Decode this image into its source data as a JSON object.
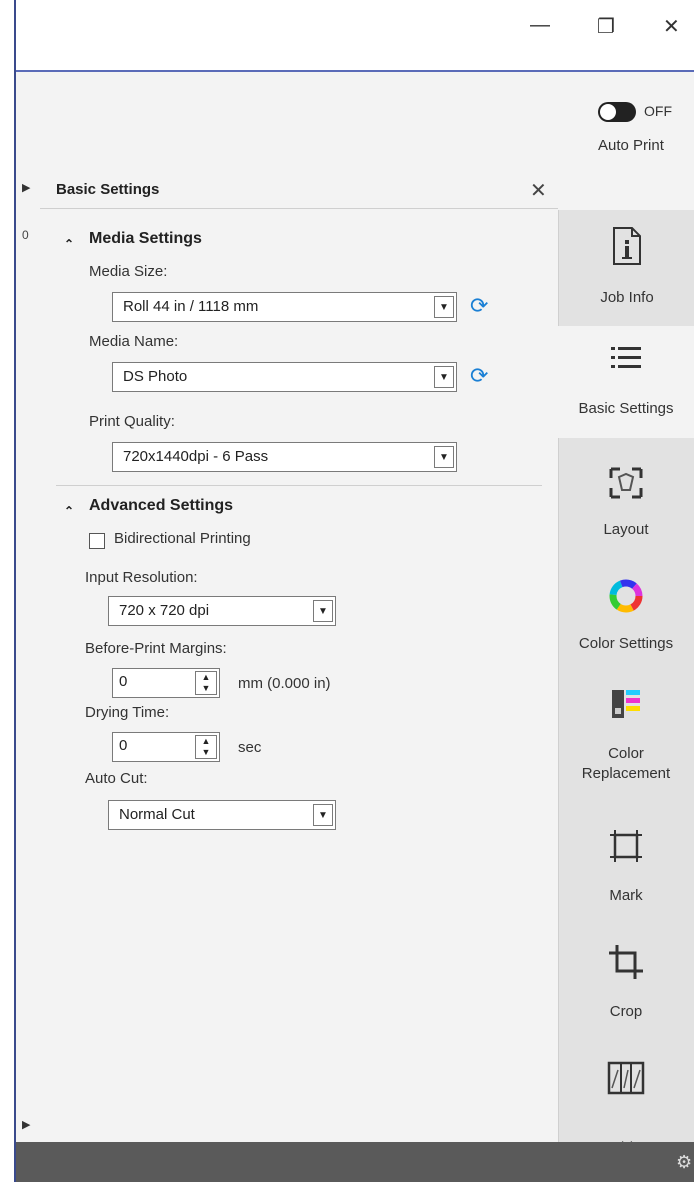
{
  "window": {
    "minimize_glyph": "—",
    "restore_glyph": "❐",
    "close_glyph": "✕"
  },
  "toolbar": {
    "auto_print_state": "OFF",
    "auto_print_label": "Auto Print"
  },
  "panel": {
    "title": "Basic Settings",
    "close_glyph": "✕",
    "media_settings": {
      "heading": "Media Settings",
      "media_size_label": "Media Size:",
      "media_size_value": "Roll 44 in / 1118 mm",
      "media_name_label": "Media Name:",
      "media_name_value": "DS Photo",
      "print_quality_label": "Print Quality:",
      "print_quality_value": "720x1440dpi - 6 Pass"
    },
    "advanced_settings": {
      "heading": "Advanced Settings",
      "bidirectional_label": "Bidirectional Printing",
      "bidirectional_checked": false,
      "input_resolution_label": "Input Resolution:",
      "input_resolution_value": "720 x 720 dpi",
      "before_print_margins_label": "Before-Print Margins:",
      "before_print_margins_value": "0",
      "before_print_margins_unit": "mm  (0.000 in)",
      "drying_time_label": "Drying Time:",
      "drying_time_value": "0",
      "drying_time_unit": "sec",
      "auto_cut_label": "Auto Cut:",
      "auto_cut_value": "Normal Cut"
    }
  },
  "nav": {
    "job_info": "Job Info",
    "basic_settings": "Basic Settings",
    "layout": "Layout",
    "color_settings": "Color Settings",
    "color_replacement_1": "Color",
    "color_replacement_2": "Replacement",
    "mark": "Mark",
    "crop": "Crop"
  },
  "left_strip": {
    "partial_char": "0"
  },
  "colors": {
    "accent": "#1a7fd4",
    "title_line": "#5a6bb8",
    "statusbar": "#5a5a5a"
  }
}
